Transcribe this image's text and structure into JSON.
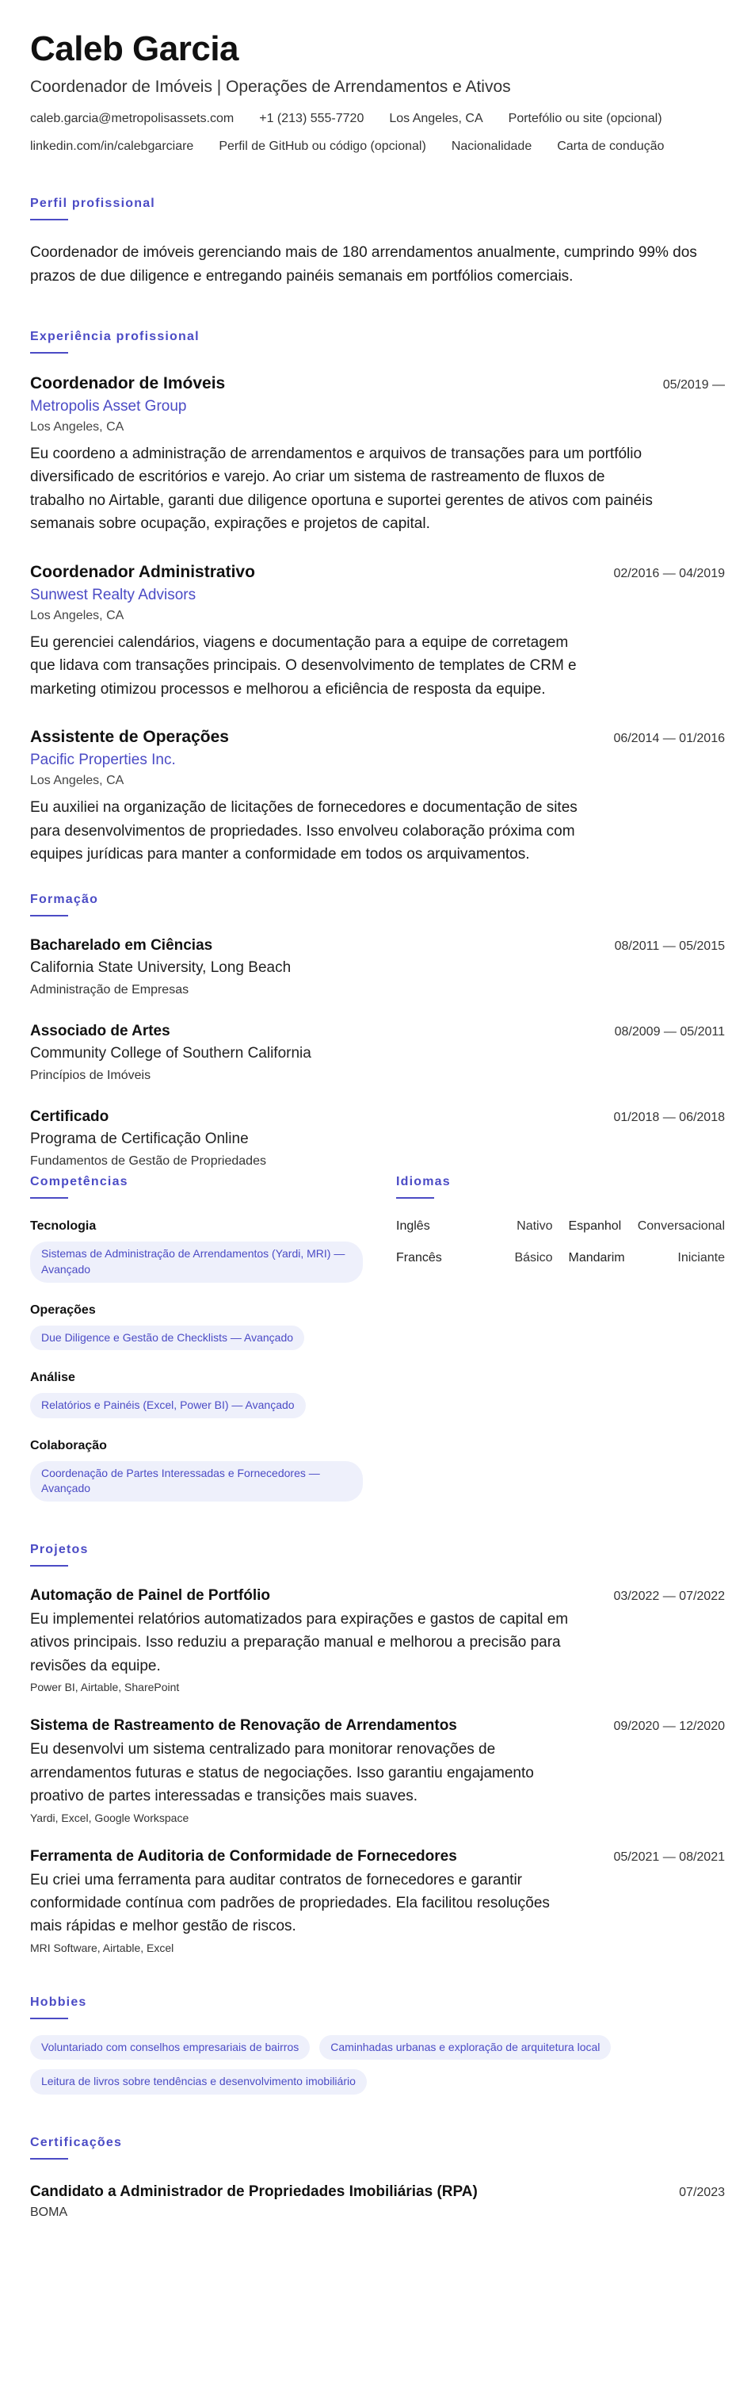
{
  "header": {
    "name": "Caleb Garcia",
    "headline": "Coordenador de Imóveis | Operações de Arrendamentos e Ativos",
    "contacts": [
      "caleb.garcia@metropolisassets.com",
      "+1 (213) 555-7720",
      "Los Angeles, CA",
      "Portefólio ou site (opcional)",
      "linkedin.com/in/calebgarciare",
      "Perfil de GitHub ou código (opcional)",
      "Nacionalidade",
      "Carta de condução"
    ]
  },
  "sections": {
    "summary": "Perfil profissional",
    "experience": "Experiência profissional",
    "education": "Formação",
    "skills": "Competências",
    "languages": "Idiomas",
    "projects": "Projetos",
    "hobbies": "Hobbies",
    "certifications": "Certificações"
  },
  "summary": "Coordenador de imóveis gerenciando mais de 180 arrendamentos anualmente, cumprindo 99% dos prazos de due diligence e entregando painéis semanais em portfólios comerciais.",
  "experience": [
    {
      "title": "Coordenador de Imóveis",
      "date": "05/2019 —",
      "company": "Metropolis Asset Group",
      "location": "Los Angeles, CA",
      "description": "Eu coordeno a administração de arrendamentos e arquivos de transações para um portfólio diversificado de escritórios e varejo. Ao criar um sistema de rastreamento de fluxos de trabalho no Airtable, garanti due diligence oportuna e suportei gerentes de ativos com painéis semanais sobre ocupação, expirações e projetos de capital."
    },
    {
      "title": "Coordenador Administrativo",
      "date": "02/2016 — 04/2019",
      "company": "Sunwest Realty Advisors",
      "location": "Los Angeles, CA",
      "description": "Eu gerenciei calendários, viagens e documentação para a equipe de corretagem que lidava com transações principais. O desenvolvimento de templates de CRM e marketing otimizou processos e melhorou a eficiência de resposta da equipe."
    },
    {
      "title": "Assistente de Operações",
      "date": "06/2014 — 01/2016",
      "company": "Pacific Properties Inc.",
      "location": "Los Angeles, CA",
      "description": "Eu auxiliei na organização de licitações de fornecedores e documentação de sites para desenvolvimentos de propriedades. Isso envolveu colaboração próxima com equipes jurídicas para manter a conformidade em todos os arquivamentos."
    }
  ],
  "education": [
    {
      "degree": "Bacharelado em Ciências",
      "date": "08/2011 — 05/2015",
      "school": "California State University, Long Beach",
      "field": "Administração de Empresas"
    },
    {
      "degree": "Associado de Artes",
      "date": "08/2009 — 05/2011",
      "school": "Community College of Southern California",
      "field": "Princípios de Imóveis"
    },
    {
      "degree": "Certificado",
      "date": "01/2018 — 06/2018",
      "school": "Programa de Certificação Online",
      "field": "Fundamentos de Gestão de Propriedades"
    }
  ],
  "skills": [
    {
      "category": "Tecnologia",
      "item": "Sistemas de Administração de Arrendamentos (Yardi, MRI) — Avançado"
    },
    {
      "category": "Operações",
      "item": "Due Diligence e Gestão de Checklists — Avançado"
    },
    {
      "category": "Análise",
      "item": "Relatórios e Painéis (Excel, Power BI) — Avançado"
    },
    {
      "category": "Colaboração",
      "item": "Coordenação de Partes Interessadas e Fornecedores — Avançado"
    }
  ],
  "languages": [
    {
      "name": "Inglês",
      "level": "Nativo"
    },
    {
      "name": "Espanhol",
      "level": "Conversacional"
    },
    {
      "name": "Francês",
      "level": "Básico"
    },
    {
      "name": "Mandarim",
      "level": "Iniciante"
    }
  ],
  "projects": [
    {
      "title": "Automação de Painel de Portfólio",
      "date": "03/2022 — 07/2022",
      "description": "Eu implementei relatórios automatizados para expirações e gastos de capital em ativos principais. Isso reduziu a preparação manual e melhorou a precisão para revisões da equipe.",
      "tech": "Power BI, Airtable, SharePoint"
    },
    {
      "title": "Sistema de Rastreamento de Renovação de Arrendamentos",
      "date": "09/2020 — 12/2020",
      "description": "Eu desenvolvi um sistema centralizado para monitorar renovações de arrendamentos futuras e status de negociações. Isso garantiu engajamento proativo de partes interessadas e transições mais suaves.",
      "tech": "Yardi, Excel, Google Workspace"
    },
    {
      "title": "Ferramenta de Auditoria de Conformidade de Fornecedores",
      "date": "05/2021 — 08/2021",
      "description": "Eu criei uma ferramenta para auditar contratos de fornecedores e garantir conformidade contínua com padrões de propriedades. Ela facilitou resoluções mais rápidas e melhor gestão de riscos.",
      "tech": "MRI Software, Airtable, Excel"
    }
  ],
  "hobbies": [
    "Voluntariado com conselhos empresariais de bairros",
    "Caminhadas urbanas e exploração de arquitetura local",
    "Leitura de livros sobre tendências e desenvolvimento imobiliário"
  ],
  "certifications": [
    {
      "title": "Candidato a Administrador de Propriedades Imobiliárias (RPA)",
      "date": "07/2023",
      "issuer": "BOMA"
    }
  ]
}
